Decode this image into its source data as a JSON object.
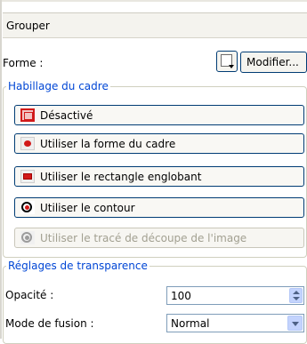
{
  "header": {
    "title": "Grouper"
  },
  "forme": {
    "label": "Forme :",
    "modify_label": "Modifier..."
  },
  "habillage": {
    "legend": "Habillage du cadre",
    "options": [
      {
        "label": "Désactivé",
        "icon": "frame-disabled-icon",
        "enabled": true
      },
      {
        "label": "Utiliser la forme du cadre",
        "icon": "frame-shape-icon",
        "enabled": true
      },
      {
        "label": "Utiliser le rectangle englobant",
        "icon": "bounding-rect-icon",
        "enabled": true
      },
      {
        "label": "Utiliser le contour",
        "icon": "contour-icon",
        "enabled": true
      },
      {
        "label": "Utiliser le tracé de découpe de l'image",
        "icon": "clip-path-icon",
        "enabled": false
      }
    ]
  },
  "transparence": {
    "legend": "Réglages de transparence",
    "opacity_label": "Opacité :",
    "opacity_value": "100",
    "blend_label": "Mode de fusion :",
    "blend_value": "Normal"
  },
  "colors": {
    "legend_blue": "#0046d5",
    "button_border": "#003c74",
    "icon_red": "#d11a1a"
  }
}
